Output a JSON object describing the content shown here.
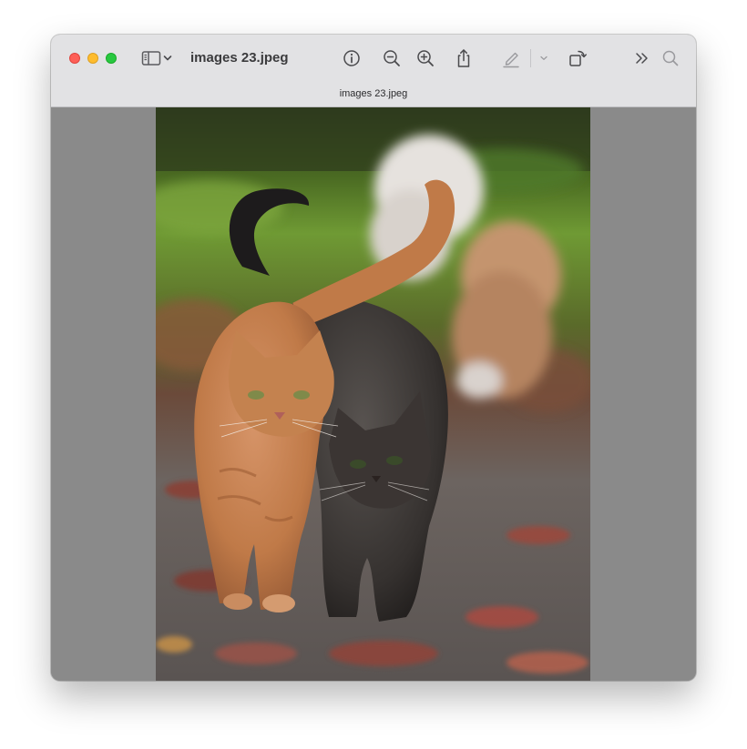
{
  "window": {
    "title": "images 23.jpeg",
    "tab_label": "images 23.jpeg"
  },
  "toolbar": {
    "icons": [
      "sidebar-icon",
      "chevron-down-icon",
      "info-icon",
      "zoom-out-icon",
      "zoom-in-icon",
      "share-icon",
      "markup-pen-icon",
      "chevron-down-icon",
      "rotate-icon",
      "more-icon",
      "search-icon"
    ]
  },
  "image": {
    "subject": "two cats walking on a leaf-covered path",
    "colors": {
      "ginger_cat": "#c8824f",
      "tabby_cat": "#3e3a38",
      "background_green": "#5f8a32",
      "ground": "#6e6664"
    }
  },
  "colors": {
    "titlebar": "#e2e2e4",
    "canvas_bg": "#8a8a8a",
    "close": "#fe5f57",
    "minimize": "#febc2e",
    "maximize": "#28c840"
  }
}
